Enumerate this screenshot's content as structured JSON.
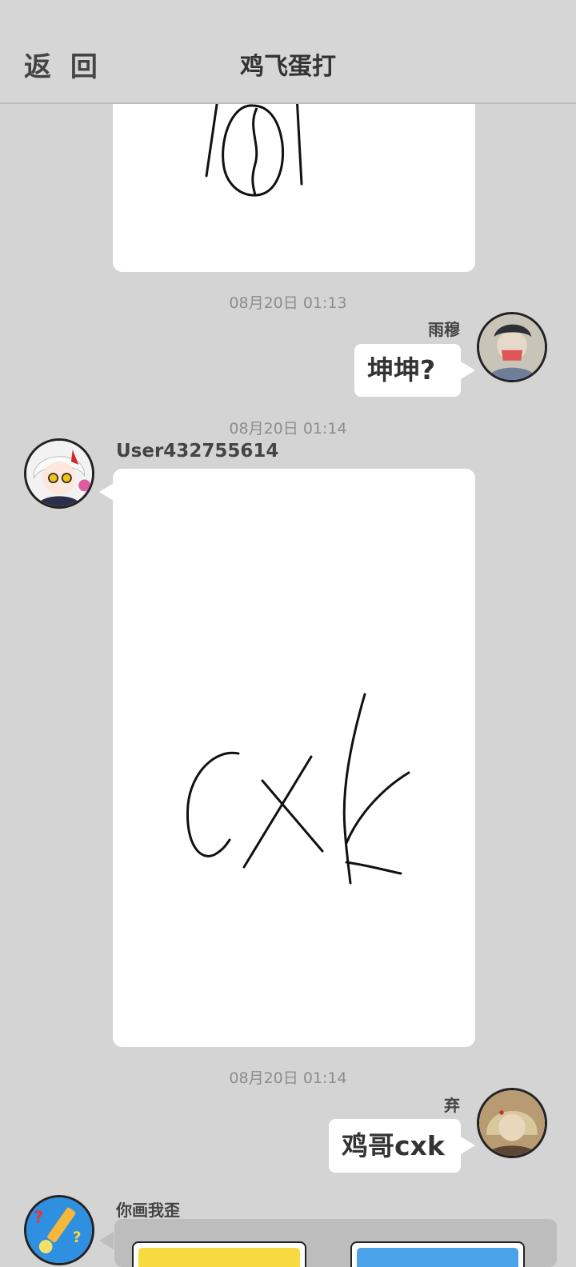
{
  "header": {
    "back_label": "返 回",
    "title": "鸡飞蛋打"
  },
  "messages": [
    {
      "type": "drawing",
      "sender": "",
      "side": "left",
      "drawing": "101-like-scribble"
    },
    {
      "type": "text",
      "timestamp": "08月20日  01:13",
      "sender": "雨穆",
      "side": "right",
      "text": "坤坤?"
    },
    {
      "type": "drawing",
      "timestamp": "08月20日  01:14",
      "sender": "User432755614",
      "side": "left",
      "drawing": "cxk-handwritten"
    },
    {
      "type": "text",
      "timestamp": "08月20日  01:14",
      "sender": "弃",
      "side": "right",
      "text": "鸡哥cxk"
    },
    {
      "type": "game-card",
      "sender": "你画我歪",
      "side": "left"
    }
  ],
  "colors": {
    "background": "#d4d4d4",
    "bubble": "#ffffff",
    "timestamp": "#8d8d8d",
    "game_card": "#bdbdbd",
    "game_yellow": "#f7d940",
    "game_blue": "#4aa3e8"
  },
  "icons": {
    "avatar_1": "avatar-dark-hair-person-icon",
    "avatar_2": "avatar-anime-white-hair-girl-icon",
    "avatar_3": "avatar-blond-person-icon",
    "avatar_4": "avatar-pencil-game-logo-icon"
  }
}
